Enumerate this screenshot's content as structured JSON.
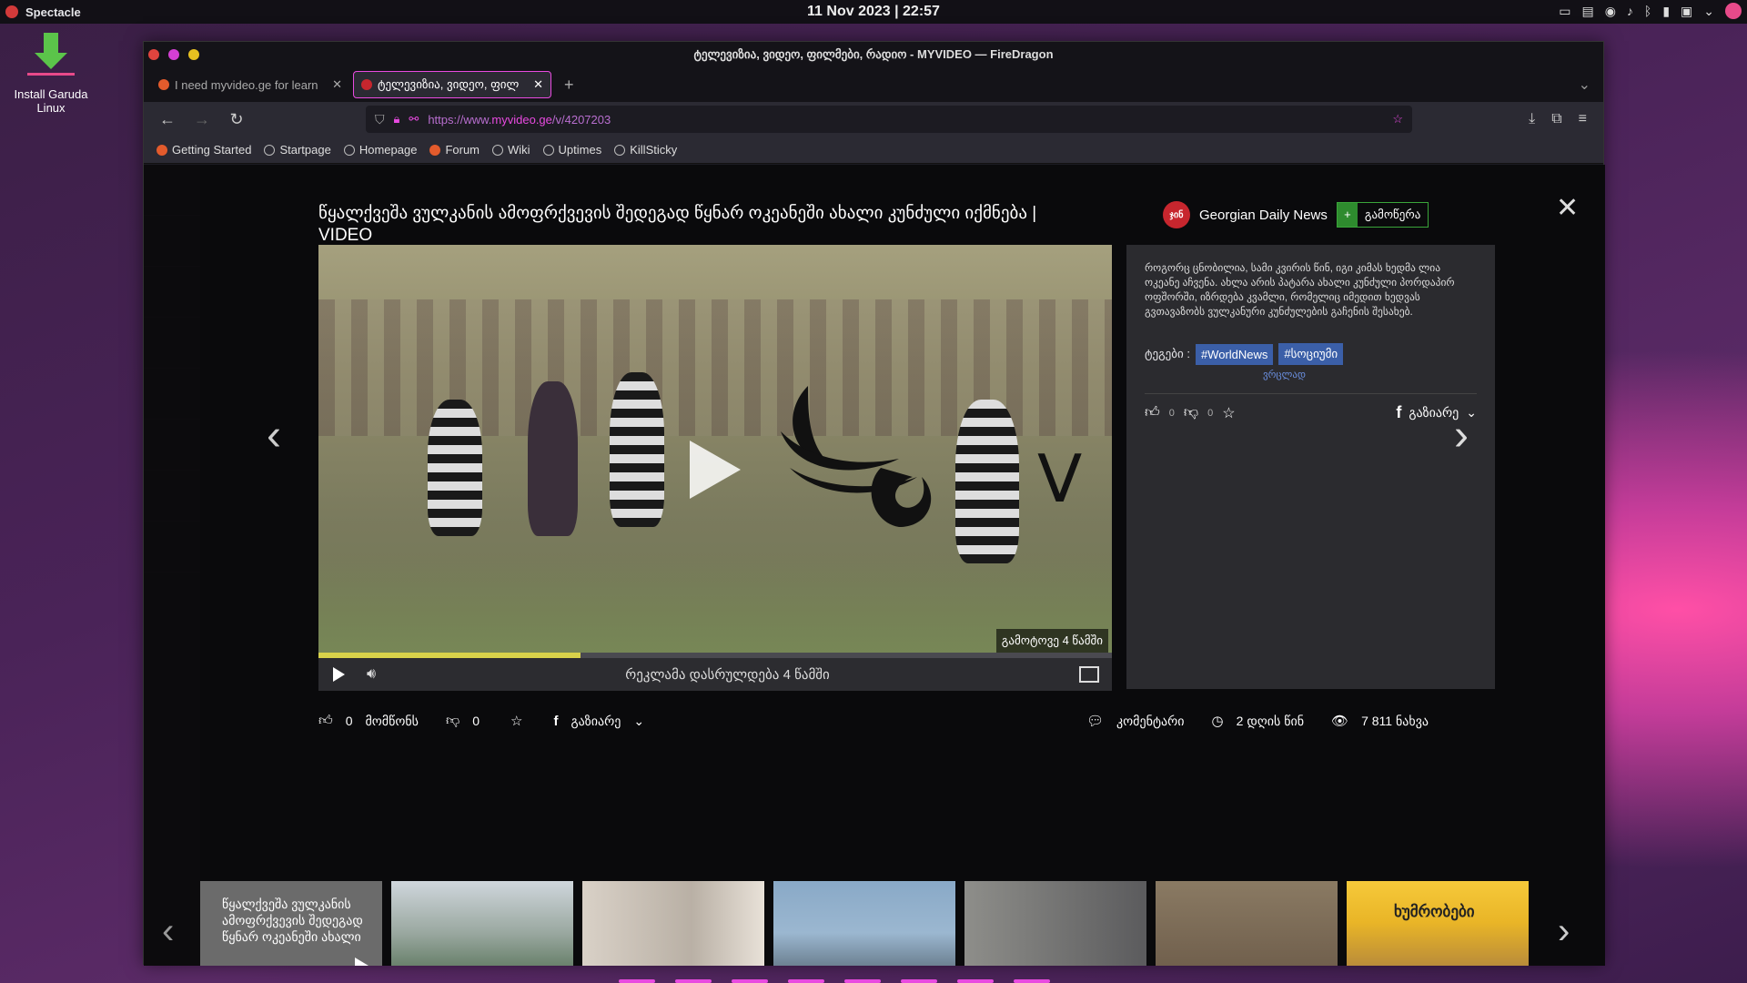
{
  "topbar": {
    "app_name": "Spectacle",
    "clock": "11 Nov 2023 | 22:57"
  },
  "desktop": {
    "icon_label_1": "Install Garuda",
    "icon_label_2": "Linux"
  },
  "window": {
    "title": "ტელევიზია, ვიდეო, ფილმები, რადიო - MYVIDEO — FireDragon",
    "tabs": [
      {
        "label": "I need myvideo.ge for learn",
        "active": false
      },
      {
        "label": "ტელევიზია, ვიდეო, ფილ",
        "active": true
      }
    ],
    "url_prefix": "https://www.",
    "url_domain": "myvideo.ge",
    "url_path": "/v/4207203",
    "bookmarks": [
      "Getting Started",
      "Startpage",
      "Homepage",
      "Forum",
      "Wiki",
      "Uptimes",
      "KillSticky"
    ]
  },
  "video": {
    "title": "წყალქვეშა ვულკანის ამოფრქვევის შედეგად წყნარ ოკეანეში ახალი კუნძული იქმნება | VIDEO",
    "channel_logo_text": "ჯინ",
    "channel_name": "Georgian Daily News",
    "subscribe_label": "გამოწერა",
    "skip_label": "გამოტოვე 4 წამში",
    "ad_message": "რეკლამა დასრულდება 4 წამში",
    "progress_fraction": 0.33,
    "logo_letter": "V"
  },
  "description": {
    "text": "როგორც ცნობილია, სამი კვირის წინ, იგი კიმას ხედმა ლია ოკეანე აჩვენა. ახლა არის პატარა ახალი კუნძული პორდაპირ ოფშორში, იზრდება კვამლი, რომელიც იმედით ხედვას გვთავაზობს ვულკანური კუნძულების გაჩენის შესახებ.",
    "tags_label": "ტეგები :",
    "tags": [
      "#WorldNews",
      "#სოციუმი"
    ],
    "more_link": "ვრცლად",
    "likes": "0",
    "dislikes": "0",
    "share_label": "გაზიარე"
  },
  "bottom": {
    "likes": "0",
    "like_label": "მომწონს",
    "dislikes": "0",
    "share_label": "გაზიარე",
    "comments_label": "კომენტარი",
    "time_label": "2 დღის წინ",
    "views_label": "7 811 ნახვა"
  },
  "strip": {
    "first_caption": "წყალქვეშა ვულკანის ამოფრქვევის შედეგად წყნარ ოკეანეში ახალი",
    "brand_text": "ხუმრობები"
  }
}
